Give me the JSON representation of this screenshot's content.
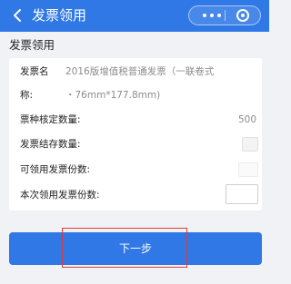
{
  "header": {
    "title": "发票领用",
    "back_icon": "chevron-left-icon",
    "more_icon": "more-dots-icon",
    "close_icon": "target-circle-icon"
  },
  "section": {
    "title": "发票领用"
  },
  "form": {
    "invoice_name_label_1": "发票名",
    "invoice_name_value_1": "2016版增值税普通发票（一联卷式",
    "invoice_name_label_2": "称:",
    "invoice_name_value_2": "・76mm*177.8mm)",
    "approved_qty_label": "票种核定数量:",
    "approved_qty_value": "500",
    "stock_qty_label": "发票结存数量:",
    "available_copies_label": "可领用发票份数:",
    "request_copies_label": "本次领用发票份数:"
  },
  "footer": {
    "next_label": "下一步"
  },
  "colors": {
    "primary": "#2f78e6",
    "highlight": "#e53935"
  }
}
